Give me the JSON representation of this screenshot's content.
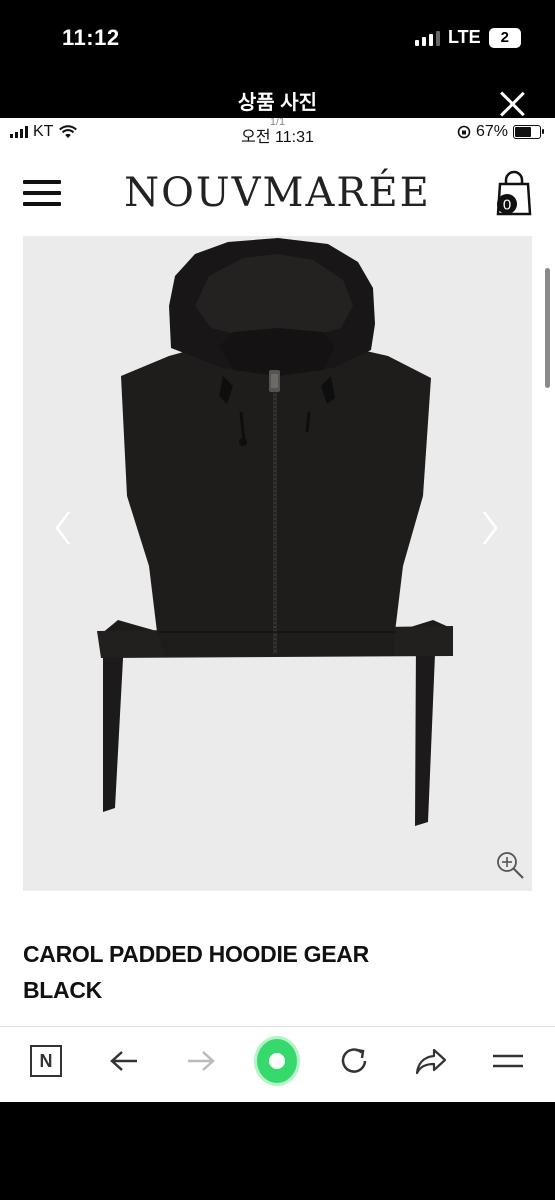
{
  "outer_status": {
    "time": "11:12",
    "network": "LTE",
    "sim": "2"
  },
  "viewer": {
    "title": "상품 사진",
    "close_icon": "close-icon"
  },
  "inner_status": {
    "carrier": "KT",
    "time": "오전 11:31",
    "page_count": "1/1",
    "battery_text": "67%",
    "battery_level": 0.67
  },
  "site": {
    "logo": "NOUVMARÉE",
    "cart_count": "0"
  },
  "product": {
    "title": "CAROL PADDED HOODIE GEAR BLACK"
  },
  "toolbar": {
    "home_label": "N"
  },
  "colors": {
    "accent_green": "#35d96c",
    "image_bg": "#ebebec",
    "garment": "#1c1a1a"
  }
}
